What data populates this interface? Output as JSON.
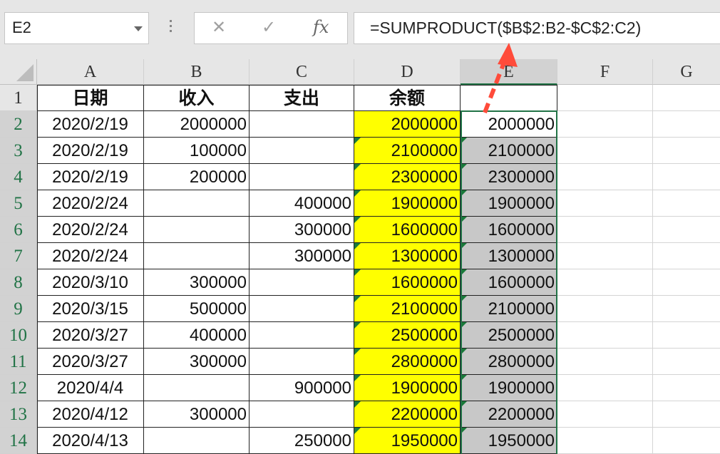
{
  "name_box": {
    "value": "E2"
  },
  "formula_bar": {
    "formula": "=SUMPRODUCT($B$2:B2-$C$2:C2)",
    "cancel_icon": "close-icon",
    "enter_icon": "check-icon",
    "insert_function_label": "fx"
  },
  "columns": [
    {
      "letter": "A"
    },
    {
      "letter": "B"
    },
    {
      "letter": "C"
    },
    {
      "letter": "D"
    },
    {
      "letter": "E"
    },
    {
      "letter": "F"
    },
    {
      "letter": "G"
    }
  ],
  "rows": [
    "1",
    "2",
    "3",
    "4",
    "5",
    "6",
    "7",
    "8",
    "9",
    "10",
    "11",
    "12",
    "13",
    "14"
  ],
  "headers": {
    "a": "日期",
    "b": "收入",
    "c": "支出",
    "d": "余额",
    "e": ""
  },
  "data": [
    {
      "date": "2020/2/19",
      "income": "2000000",
      "expense": "",
      "balance": "2000000",
      "result": "2000000"
    },
    {
      "date": "2020/2/19",
      "income": "100000",
      "expense": "",
      "balance": "2100000",
      "result": "2100000"
    },
    {
      "date": "2020/2/19",
      "income": "200000",
      "expense": "",
      "balance": "2300000",
      "result": "2300000"
    },
    {
      "date": "2020/2/24",
      "income": "",
      "expense": "400000",
      "balance": "1900000",
      "result": "1900000"
    },
    {
      "date": "2020/2/24",
      "income": "",
      "expense": "300000",
      "balance": "1600000",
      "result": "1600000"
    },
    {
      "date": "2020/2/24",
      "income": "",
      "expense": "300000",
      "balance": "1300000",
      "result": "1300000"
    },
    {
      "date": "2020/3/10",
      "income": "300000",
      "expense": "",
      "balance": "1600000",
      "result": "1600000"
    },
    {
      "date": "2020/3/15",
      "income": "500000",
      "expense": "",
      "balance": "2100000",
      "result": "2100000"
    },
    {
      "date": "2020/3/27",
      "income": "400000",
      "expense": "",
      "balance": "2500000",
      "result": "2500000"
    },
    {
      "date": "2020/3/27",
      "income": "300000",
      "expense": "",
      "balance": "2800000",
      "result": "2800000"
    },
    {
      "date": "2020/4/4",
      "income": "",
      "expense": "900000",
      "balance": "1900000",
      "result": "1900000"
    },
    {
      "date": "2020/4/12",
      "income": "300000",
      "expense": "",
      "balance": "2200000",
      "result": "2200000"
    },
    {
      "date": "2020/4/13",
      "income": "",
      "expense": "250000",
      "balance": "1950000",
      "result": "1950000"
    }
  ],
  "colors": {
    "highlight": "#ffff00",
    "filled": "#c8c8c8",
    "accent": "#217346",
    "annotation_arrow": "#ff4b3a"
  }
}
